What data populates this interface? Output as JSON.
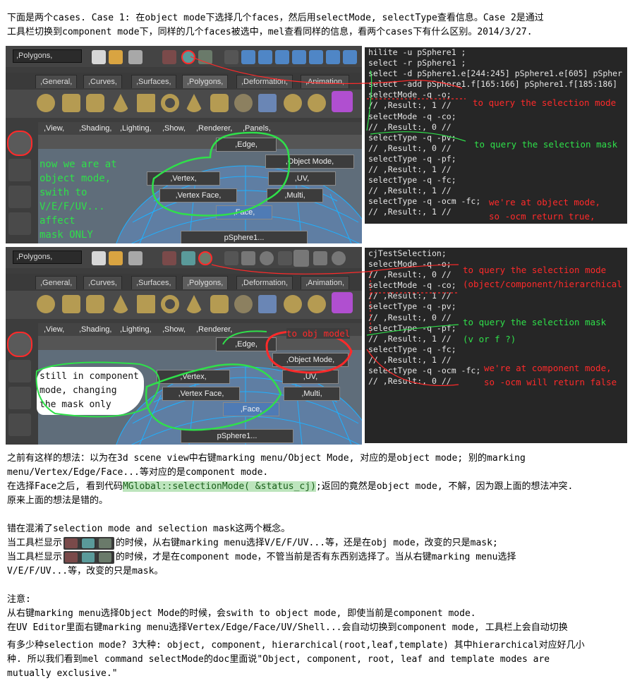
{
  "intro": {
    "line1": "下面是两个cases. Case 1: 在object mode下选择几个faces，然后用selectMode, selectType查看信息。Case 2是通过",
    "line2": "工具栏切换到component mode下，同样的几个faces被选中，mel查看同样的信息，看两个cases下有什么区别。2014/3/27."
  },
  "maya": {
    "menu_combo": ",Polygons,",
    "shelf_tabs": [
      ",General,",
      ",Curves,",
      ",Surfaces,",
      ",Polygons,",
      ",Deformation,",
      ",Animation,"
    ],
    "panel_menus": [
      ",View,",
      ",Shading,",
      ",Lighting,",
      ",Show,",
      ",Renderer,",
      ",Panels,"
    ],
    "marking_menu": {
      "edge": ",Edge,",
      "object_mode": ",Object Mode,",
      "vertex": ",Vertex,",
      "uv": ",UV,",
      "vertex_face": ",Vertex Face,",
      "multi": ",Multi,",
      "face": ",Face,"
    },
    "object_label": "pSphere1..."
  },
  "case1": {
    "console": [
      "hilite -u pSphere1 ;",
      "select -r pSphere1 ;",
      "select -d pSphere1.e[244:245] pSphere1.e[605] pSpher",
      "select -add pSphere1.f[165:166] pSphere1.f[185:186]",
      "selectMode -q -o;",
      "// ,Result:, 1 //",
      "selectMode -q -co;",
      "// ,Result:, 0 //",
      "selectType -q -pv;",
      "// ,Result:, 0 //",
      "selectType -q -pf;",
      "// ,Result:, 1 //",
      "selectType -q -fc;",
      "// ,Result:, 1 //",
      "selectType -q -ocm -fc;",
      "// ,Result:, 1 //"
    ],
    "anno_mode": "to query the selection mode",
    "anno_mask": "to query the selection mask",
    "anno_ocm1": "we're at object mode,",
    "anno_ocm2": "so -ocm return true,",
    "green_note": [
      "now we are at",
      "object mode,",
      "swith to",
      "V/E/F/UV...",
      "affect",
      "mask ONLY"
    ]
  },
  "case2": {
    "console": [
      "cjTestSelection;",
      "selectMode -q -o;",
      "// ,Result:, 0 //",
      "selectMode -q -co;",
      "// ,Result:, 1 //",
      "selectType -q -pv;",
      "// ,Result:, 0 //",
      "selectType -q -pf;",
      "// ,Result:, 1 //",
      "selectType -q -fc;",
      "// ,Result:, 1 //",
      "selectType -q -ocm -fc;",
      "// ,Result:, 0 //"
    ],
    "anno_mode1": "to query the selection mode",
    "anno_mode2": "(object/component/hierarchical",
    "anno_mask1": "to query the selection mask",
    "anno_mask2": "(v or f ?)",
    "anno_ocm1": "we're at component mode,",
    "anno_ocm2": "so -ocm will return false",
    "anno_obj": "to obj model",
    "white_note": [
      "still in component",
      "mode, changing",
      "the mask only"
    ]
  },
  "body": {
    "p1_l1": "之前有这样的想法：以为在3d scene view中右键marking menu/Object Mode, 对应的是object mode; 别的marking",
    "p1_l2": "menu/Vertex/Edge/Face...等对应的是component mode.",
    "p1_l3_a": "在选择Face之后, 看到代码",
    "p1_l3_code": "MGlobal::selectionMode( &status_cj)",
    "p1_l3_b": ";返回的竟然是object mode, 不解，因为跟上面的想法冲突.",
    "p1_l4": "原来上面的想法是错的。",
    "p2_l1": "错在混淆了selection mode and selection mask这两个概念。",
    "p2_l2_a": "当工具栏显示",
    "p2_l2_b": "的时候，从右键marking menu选择V/E/F/UV...等，还是在obj mode，改变的只是mask;",
    "p2_l3_a": "当工具栏显示",
    "p2_l3_b": "的时候，才是在component mode，不管当前是否有东西别选择了。当从右键marking menu选择",
    "p2_l4": "V/E/F/UV...等，改变的只是mask。",
    "note_title": "注意:",
    "note_l1": "从右键marking menu选择Object Mode的时候，会swith to object mode, 即使当前是component mode.",
    "note_l2": "在UV Editor里面右键marking menu选择Vertex/Edge/Face/UV/Shell...会自动切换到component mode, 工具栏上会自动切换",
    "q_l1": "有多少种selection mode? 3大种: object, component, hierarchical(root,leaf,template) 其中hierarchical对应好几小",
    "q_l2": "种. 所以我们看到mel command selectMode的doc里面说\"Object, component, root, leaf and template modes are",
    "q_l3": "mutually exclusive.\""
  },
  "colors": {
    "annotation_red": "#ff2a2a",
    "annotation_green": "#2fe04a",
    "console_bg": "#262626",
    "maya_bg": "#3d3d3d"
  }
}
